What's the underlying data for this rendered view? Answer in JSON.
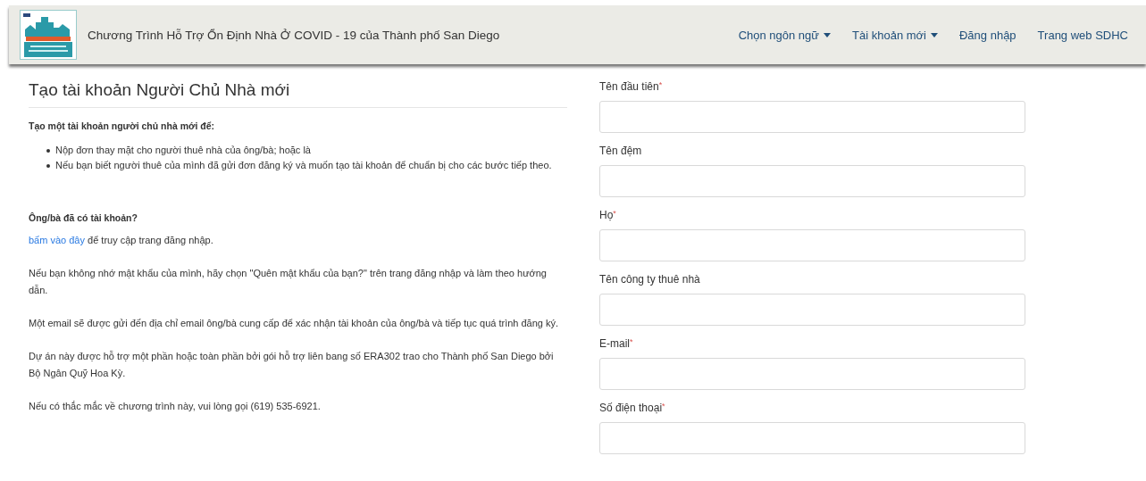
{
  "navbar": {
    "title": "Chương Trình Hỗ Trợ Ổn Định Nhà Ở COVID - 19 của Thành phố San Diego",
    "links": [
      {
        "label": "Chọn ngôn ngữ",
        "dropdown": true
      },
      {
        "label": "Tài khoản mới",
        "dropdown": true
      },
      {
        "label": "Đăng nhập",
        "dropdown": false
      },
      {
        "label": "Trang web SDHC",
        "dropdown": false
      }
    ]
  },
  "intro": {
    "heading": "Tạo tài khoản Người Chủ Nhà mới",
    "lead": "Tạo một tài khoản người chủ nhà mới để:",
    "bullets": [
      "Nộp đơn thay mặt cho người thuê nhà của ông/bà; hoặc là",
      "Nếu bạn biết người thuê của mình đã gửi đơn đăng ký và muốn tạo tài khoản để chuẩn bị cho các bước tiếp theo."
    ],
    "account_question": "Ông/bà đã có tài khoản?",
    "login_link": "bấm vào đây",
    "login_text": " để truy cập trang đăng nhập.",
    "paragraphs": [
      "Nếu bạn không nhớ mật khẩu của mình, hãy chọn \"Quên mật khẩu của bạn?\" trên trang đăng nhập và làm theo hướng dẫn.",
      "Một email sẽ được gửi đến địa chỉ email ông/bà cung cấp để xác nhận tài khoản của ông/bà và tiếp tục quá trình đăng ký.",
      "Dự án này được hỗ trợ một phần hoặc toàn phần bởi gói hỗ trợ liên bang số ERA302 trao cho Thành phố San Diego bởi Bộ Ngân Quỹ Hoa Kỳ.",
      "Nếu có thắc mắc về chương trình này, vui lòng gọi (619) 535-6921."
    ]
  },
  "form": {
    "fields": [
      {
        "label": "Tên đầu tiên",
        "required_mark": "*"
      },
      {
        "label": "Tên đệm"
      },
      {
        "label": "Họ",
        "required_mark": "*"
      },
      {
        "label": "Tên công ty thuê nhà"
      },
      {
        "label": "E-mail",
        "required_mark": "*"
      },
      {
        "label": "Số điện thoại",
        "required_mark": "*"
      }
    ]
  }
}
